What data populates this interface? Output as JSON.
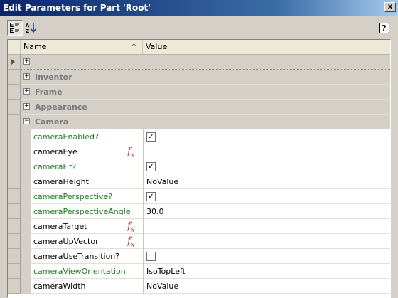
{
  "window": {
    "title": "Edit Parameters for Part 'Root'",
    "close_glyph": "x"
  },
  "toolbar": {
    "categorized_icon": "categorized-view-icon",
    "alphabetical_icon": "alphabetical-sort-icon",
    "help_glyph": "?"
  },
  "header": {
    "name": "Name",
    "value": "Value"
  },
  "categories": [
    {
      "label": "",
      "expander": "+"
    },
    {
      "label": "Inventor",
      "expander": "+"
    },
    {
      "label": "Frame",
      "expander": "+"
    },
    {
      "label": "Appearance",
      "expander": "+"
    },
    {
      "label": "Camera",
      "expander": "−"
    }
  ],
  "properties": [
    {
      "name": "cameraEnabled?",
      "color": "green",
      "value_type": "checkbox",
      "value": "checked",
      "fx": false
    },
    {
      "name": "cameraEye",
      "color": "black",
      "value_type": "text",
      "value": "",
      "fx": true
    },
    {
      "name": "cameraFit?",
      "color": "green",
      "value_type": "checkbox",
      "value": "checked",
      "fx": false
    },
    {
      "name": "cameraHeight",
      "color": "black",
      "value_type": "text",
      "value": "NoValue",
      "fx": false
    },
    {
      "name": "cameraPerspective?",
      "color": "green",
      "value_type": "checkbox",
      "value": "checked",
      "fx": false
    },
    {
      "name": "cameraPerspectiveAngle",
      "color": "green",
      "value_type": "text",
      "value": "30.0",
      "fx": false
    },
    {
      "name": "cameraTarget",
      "color": "black",
      "value_type": "text",
      "value": "",
      "fx": true
    },
    {
      "name": "cameraUpVector",
      "color": "black",
      "value_type": "text",
      "value": "",
      "fx": true
    },
    {
      "name": "cameraUseTransition?",
      "color": "black",
      "value_type": "checkbox",
      "value": "unchecked",
      "fx": false
    },
    {
      "name": "cameraViewOrientation",
      "color": "green",
      "value_type": "text",
      "value": "IsoTopLeft",
      "fx": false
    },
    {
      "name": "cameraWidth",
      "color": "black",
      "value_type": "text",
      "value": "NoValue",
      "fx": false
    }
  ],
  "fx_label": {
    "f": "f",
    "x": "x"
  },
  "colors": {
    "title_bar": "#0a246a",
    "green_name": "#1e7c1e",
    "fx": "#b04040"
  }
}
